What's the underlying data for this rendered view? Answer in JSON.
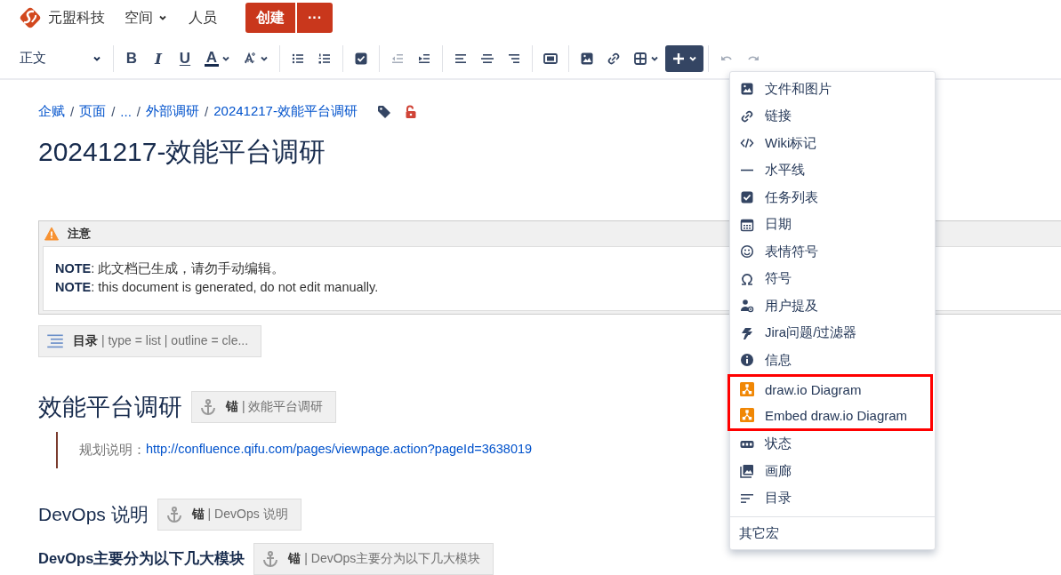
{
  "nav": {
    "brand": "元盟科技",
    "links": [
      {
        "label": "空间",
        "caret": true
      },
      {
        "label": "人员",
        "caret": false
      }
    ],
    "create": "创建",
    "more": "···"
  },
  "toolbar": {
    "style_select": "正文",
    "groups": [
      [
        {
          "kind": "bold",
          "label": "B",
          "caret": false,
          "disabled": false,
          "expanded": false
        },
        {
          "kind": "italic",
          "label": "I",
          "caret": false,
          "disabled": false,
          "expanded": false
        },
        {
          "kind": "underline",
          "label": "U",
          "caret": false,
          "disabled": false,
          "expanded": false
        },
        {
          "kind": "text-color",
          "label": "A",
          "caret": true,
          "disabled": false,
          "expanded": false
        },
        {
          "kind": "text-style",
          "caret": true,
          "disabled": false,
          "expanded": false
        }
      ],
      [
        {
          "kind": "bullets",
          "caret": false,
          "disabled": false,
          "expanded": false
        },
        {
          "kind": "numbered",
          "caret": false,
          "disabled": false,
          "expanded": false
        }
      ],
      [
        {
          "kind": "task",
          "caret": false,
          "disabled": false,
          "expanded": false
        }
      ],
      [
        {
          "kind": "outdent",
          "caret": false,
          "disabled": true,
          "expanded": false
        },
        {
          "kind": "indent",
          "caret": false,
          "disabled": false,
          "expanded": false
        }
      ],
      [
        {
          "kind": "align-left",
          "caret": false,
          "disabled": false,
          "expanded": false
        },
        {
          "kind": "align-center",
          "caret": false,
          "disabled": false,
          "expanded": false
        },
        {
          "kind": "align-right",
          "caret": false,
          "disabled": false,
          "expanded": false
        }
      ],
      [
        {
          "kind": "layout",
          "caret": false,
          "disabled": false,
          "expanded": false
        }
      ],
      [
        {
          "kind": "image",
          "caret": false,
          "disabled": false,
          "expanded": false
        },
        {
          "kind": "link",
          "caret": false,
          "disabled": false,
          "expanded": false
        },
        {
          "kind": "table",
          "caret": true,
          "disabled": false,
          "expanded": false
        },
        {
          "kind": "insert",
          "caret": true,
          "disabled": false,
          "expanded": true
        }
      ],
      [
        {
          "kind": "undo",
          "caret": false,
          "disabled": true,
          "expanded": false
        },
        {
          "kind": "redo",
          "caret": false,
          "disabled": true,
          "expanded": false
        }
      ]
    ]
  },
  "breadcrumbs": [
    {
      "kind": "link",
      "text": "企赋"
    },
    {
      "kind": "sep",
      "text": "/"
    },
    {
      "kind": "link",
      "text": "页面"
    },
    {
      "kind": "sep",
      "text": "/"
    },
    {
      "kind": "link",
      "text": "..."
    },
    {
      "kind": "sep",
      "text": "/"
    },
    {
      "kind": "link",
      "text": "外部调研"
    },
    {
      "kind": "sep",
      "text": "/"
    },
    {
      "kind": "link",
      "text": "20241217-效能平台调研"
    }
  ],
  "title": "20241217-效能平台调研",
  "warning_panel": {
    "title": "注意",
    "lines": [
      "**NOTE**: 此文档已生成，请勿手动编辑。",
      "**NOTE**: this document is generated, do not edit manually."
    ]
  },
  "toc_macro": "**目录** | type = list | outline = cle...",
  "sections": [
    {
      "kind": "h1",
      "text": "效能平台调研",
      "anchor": "**锚** | 效能平台调研"
    },
    {
      "kind": "quote",
      "label": "规划说明：",
      "link": "http://confluence.qifu.com/pages/viewpage.action?pageId=3638019"
    },
    {
      "kind": "h2",
      "text": "DevOps 说明",
      "anchor": "**锚** | DevOps 说明"
    },
    {
      "kind": "h4",
      "text": "DevOps主要分为以下几大模块",
      "anchor": "**锚** | DevOps主要分为以下几大模块"
    }
  ],
  "insert_menu": {
    "items": [
      {
        "kind": "image",
        "label": "文件和图片",
        "highlighted": false
      },
      {
        "kind": "link",
        "label": "链接",
        "highlighted": false
      },
      {
        "kind": "code",
        "label": "Wiki标记",
        "highlighted": false
      },
      {
        "kind": "hr",
        "label": "水平线",
        "highlighted": false
      },
      {
        "kind": "task",
        "label": "任务列表",
        "highlighted": false
      },
      {
        "kind": "calendar",
        "label": "日期",
        "highlighted": false
      },
      {
        "kind": "emoji",
        "label": "表情符号",
        "highlighted": false
      },
      {
        "kind": "omega",
        "label": "符号",
        "highlighted": false
      },
      {
        "kind": "mention",
        "label": "用户提及",
        "highlighted": false
      },
      {
        "kind": "jira",
        "label": "Jira问题/过滤器",
        "highlighted": false
      },
      {
        "kind": "info",
        "label": "信息",
        "highlighted": false
      },
      {
        "kind": "drawio",
        "label": "draw.io Diagram",
        "highlighted": true
      },
      {
        "kind": "drawio",
        "label": "Embed draw.io Diagram",
        "highlighted": true
      },
      {
        "kind": "status",
        "label": "状态",
        "highlighted": false
      },
      {
        "kind": "gallery",
        "label": "画廊",
        "highlighted": false
      },
      {
        "kind": "toc",
        "label": "目录",
        "highlighted": false
      }
    ],
    "footer": "其它宏"
  }
}
